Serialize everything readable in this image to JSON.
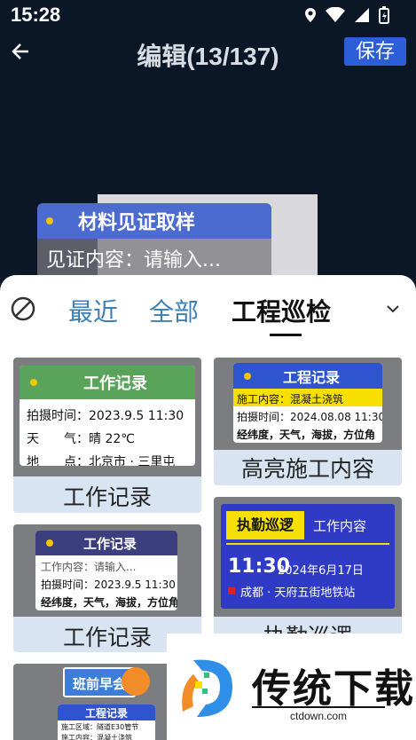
{
  "status_bar": {
    "time": "15:28"
  },
  "header": {
    "title": "编辑(13/137)",
    "save_label": "保存"
  },
  "preview": {
    "watermark_title": "材料见证取样",
    "watermark_field": "见证内容：请输入..."
  },
  "tabs": {
    "recent": "最近",
    "all": "全部",
    "inspection": "工程巡检"
  },
  "templates": [
    {
      "label": "工作记录",
      "header": "工作记录",
      "rows": [
        "拍摄时间：2023.9.5 11:30",
        "天　　气：晴 22℃",
        "地　　点：北京市 · 三里屯"
      ]
    },
    {
      "label": "高亮施工内容",
      "header": "工程记录",
      "highlight": "施工内容：混凝土浇筑",
      "rows": [
        "拍摄时间：2024.08.08 11:30",
        "经纬度，天气，海拔，方位角"
      ]
    },
    {
      "label": "工作记录",
      "header": "工作记录",
      "rows": [
        "工作内容：请输入...",
        "拍摄时间：2023.9.5 11:30",
        "经纬度，天气，海拔，方位角"
      ]
    },
    {
      "label": "执勤巡逻",
      "tag": "执勤巡逻",
      "content": "工作内容",
      "time": "11:30",
      "date": "2024年6月17日",
      "place": "成都 · 天府五街地铁站"
    },
    {
      "label": "",
      "badge": "班前早会",
      "header": "工程记录",
      "rows": [
        "施工区域：隧道E30管节",
        "施工内容：混凝土浇筑"
      ]
    }
  ],
  "watermark_logo": {
    "brand": "传统下载",
    "url": "ctdown.com"
  },
  "colors": {
    "accent": "#2b5ed8",
    "tab_inactive": "#3e7fb3",
    "card_bg": "#d9e4f2"
  }
}
